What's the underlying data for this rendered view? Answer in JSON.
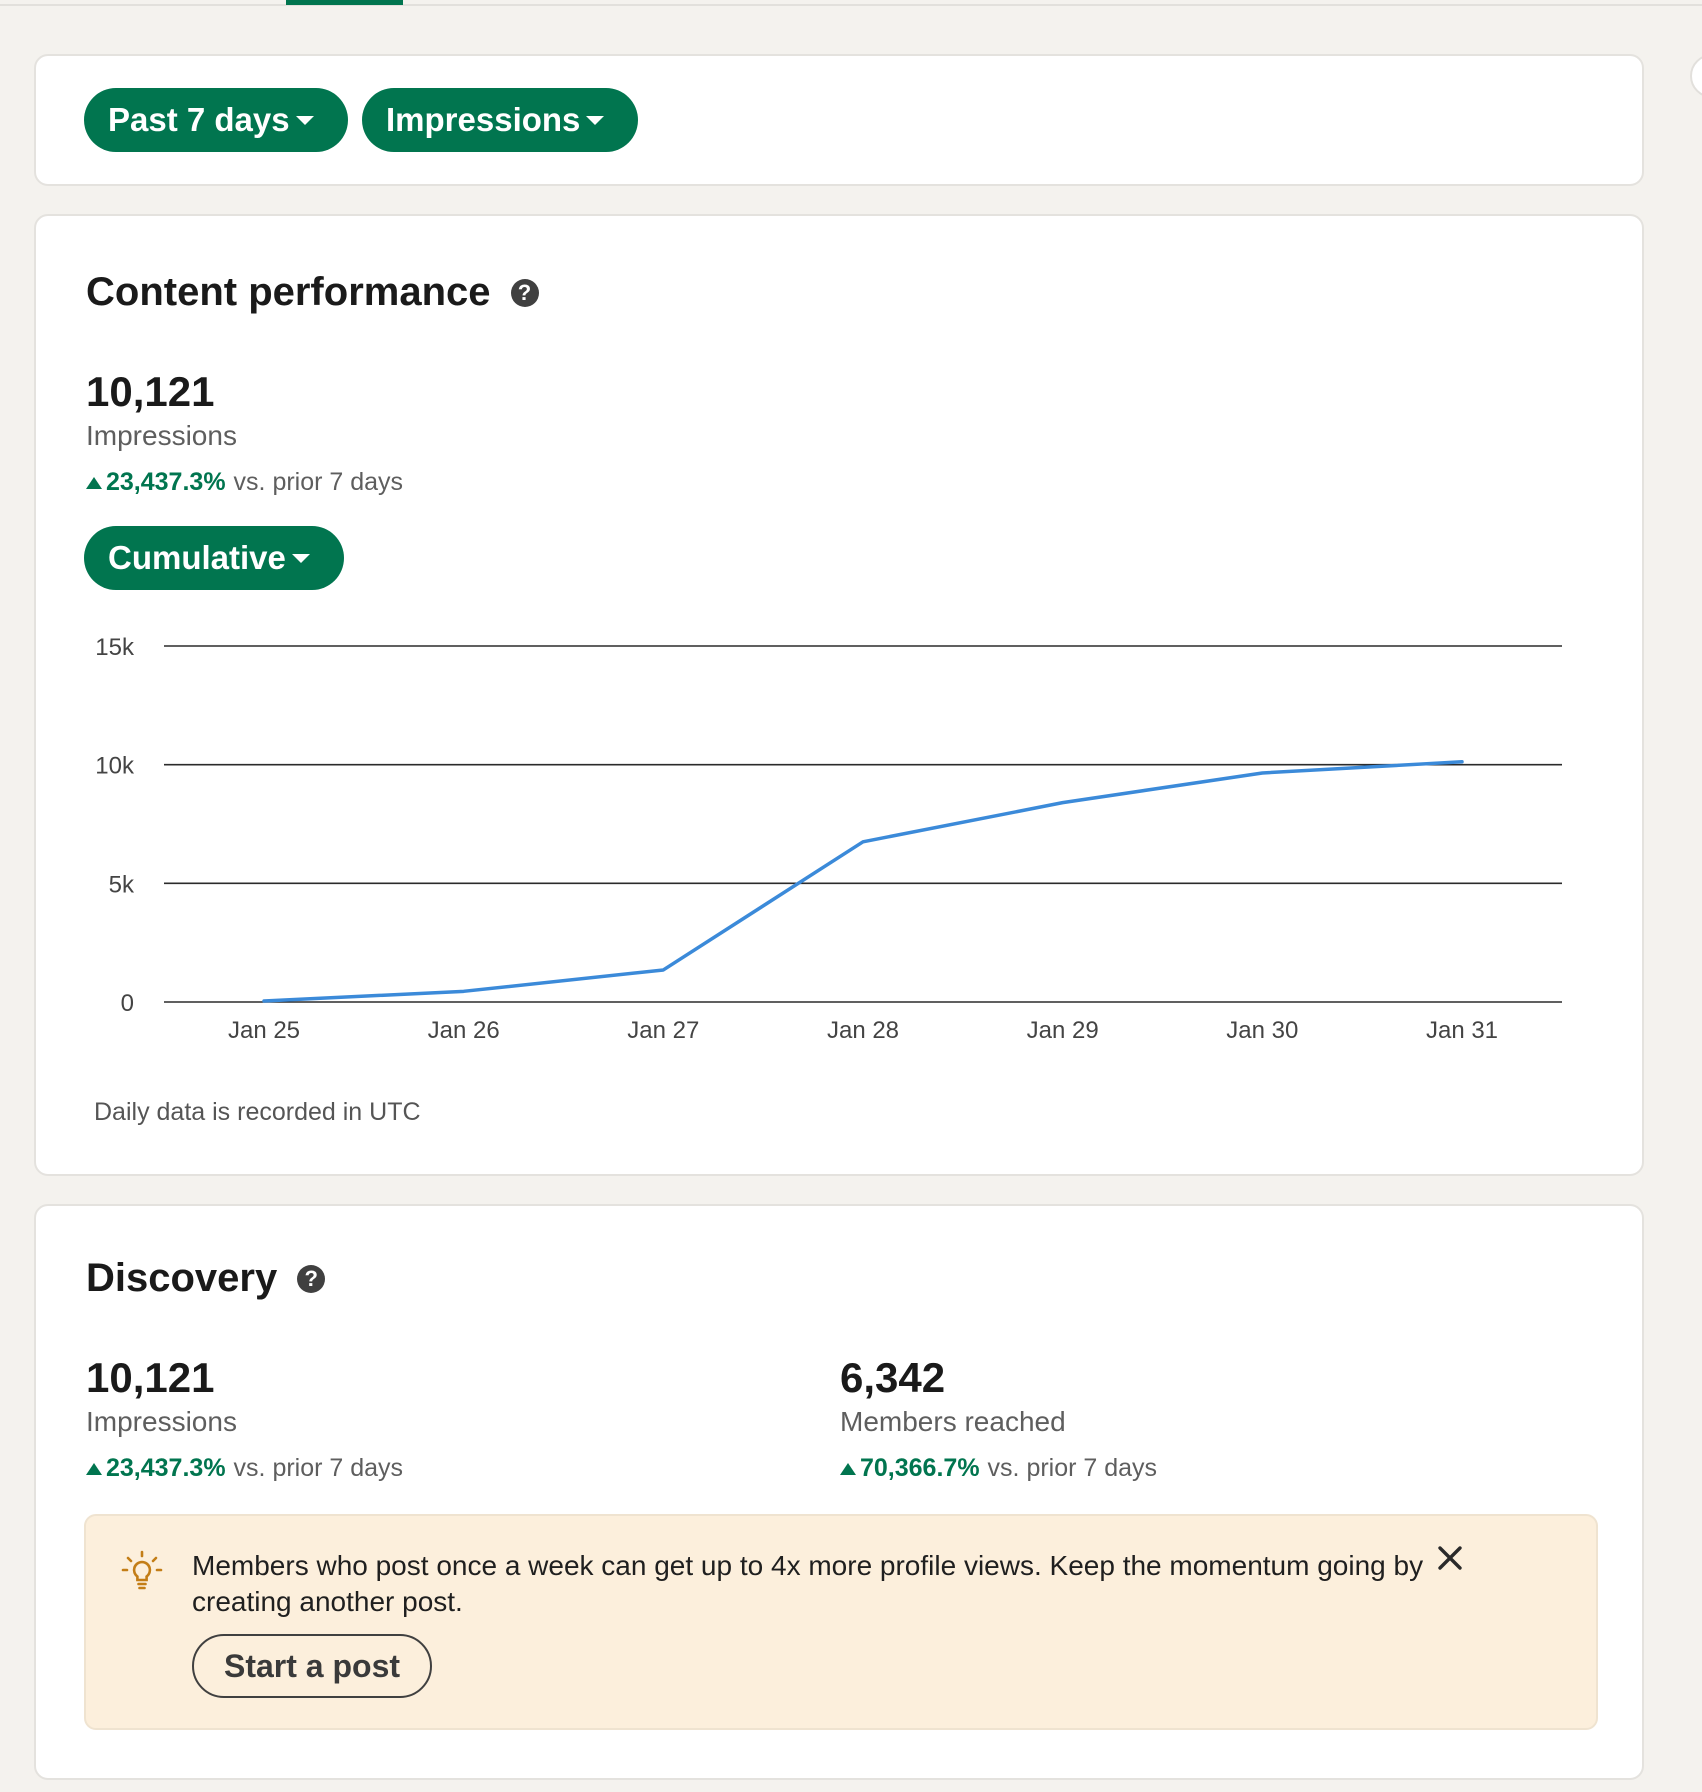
{
  "filters": {
    "range_label": "Past 7 days",
    "metric_label": "Impressions"
  },
  "performance": {
    "title": "Content performance",
    "total": "10,121",
    "label": "Impressions",
    "change_pct": "23,437.3%",
    "change_suffix": "vs. prior 7 days",
    "mode_label": "Cumulative",
    "note": "Daily data is recorded in UTC"
  },
  "chart_data": {
    "type": "line",
    "x": [
      "Jan 25",
      "Jan 26",
      "Jan 27",
      "Jan 28",
      "Jan 29",
      "Jan 30",
      "Jan 31"
    ],
    "series": [
      {
        "values": [
          40,
          450,
          1350,
          6750,
          8400,
          9650,
          10121
        ]
      }
    ],
    "yticks": [
      "0",
      "5k",
      "10k",
      "15k"
    ],
    "ylim": [
      0,
      15000
    ],
    "grid": true,
    "line_color": "#3b8ad9"
  },
  "discovery": {
    "title": "Discovery",
    "impressions": {
      "value": "10,121",
      "label": "Impressions",
      "change_pct": "23,437.3%",
      "change_suffix": "vs. prior 7 days"
    },
    "members": {
      "value": "6,342",
      "label": "Members reached",
      "change_pct": "70,366.7%",
      "change_suffix": "vs. prior 7 days"
    },
    "tip": {
      "text": "Members who post once a week can get up to 4x more profile views. Keep the momentum going by creating another post.",
      "button_label": "Start a post"
    }
  },
  "colors": {
    "accent": "#01754f",
    "increase": "#01754f",
    "tip_background": "#fcefdc"
  }
}
